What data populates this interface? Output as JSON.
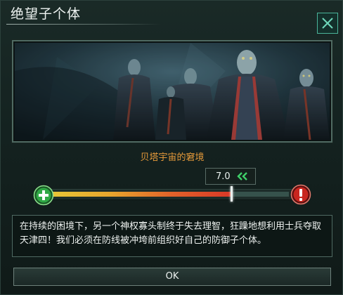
{
  "dialog": {
    "title": "绝望子个体",
    "image_caption": "贝塔宇宙的窘境",
    "meter": {
      "value_text": "7.0",
      "fill_fraction": 0.76,
      "fill_gradient": [
        "#e8c637",
        "#e8a62d",
        "#e2632a",
        "#d93827"
      ],
      "left_icon": "plus-circle-icon",
      "right_icon": "warning-circle-icon",
      "trend_icon": "double-chevron-left-icon"
    },
    "description": "在持续的困境下，另一个神权寡头制终于失去理智，狂躁地想利用士兵夺取天津四！我们必须在防线被冲垮前组织好自己的防御子个体。",
    "ok_label": "OK"
  },
  "colors": {
    "accent_teal": "#4bb59a",
    "caption_orange": "#e69a3a",
    "good_green": "#2fa845",
    "danger_red": "#c9261f"
  }
}
